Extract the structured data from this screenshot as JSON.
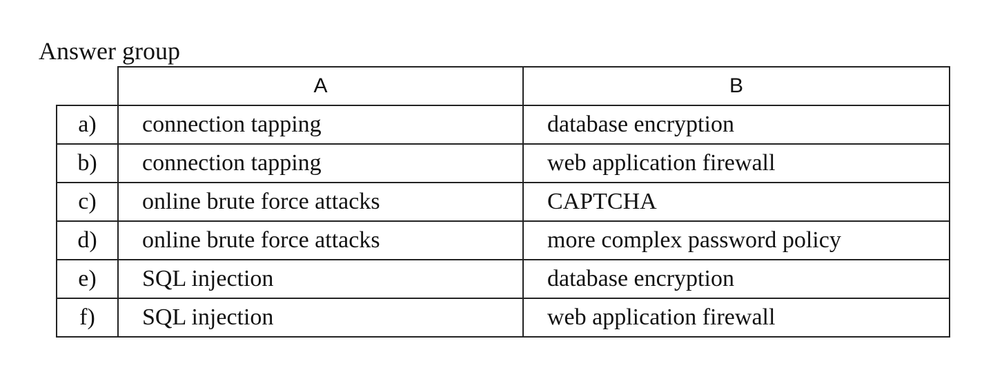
{
  "title": "Answer group",
  "columns": {
    "a": "A",
    "b": "B"
  },
  "rows": [
    {
      "key": "a)",
      "a": "connection tapping",
      "b": "database encryption"
    },
    {
      "key": "b)",
      "a": "connection tapping",
      "b": "web application firewall"
    },
    {
      "key": "c)",
      "a": "online brute force attacks",
      "b": "CAPTCHA"
    },
    {
      "key": "d)",
      "a": "online brute force attacks",
      "b": "more complex password policy"
    },
    {
      "key": "e)",
      "a": "SQL injection",
      "b": "database encryption"
    },
    {
      "key": "f)",
      "a": "SQL injection",
      "b": "web application firewall"
    }
  ]
}
